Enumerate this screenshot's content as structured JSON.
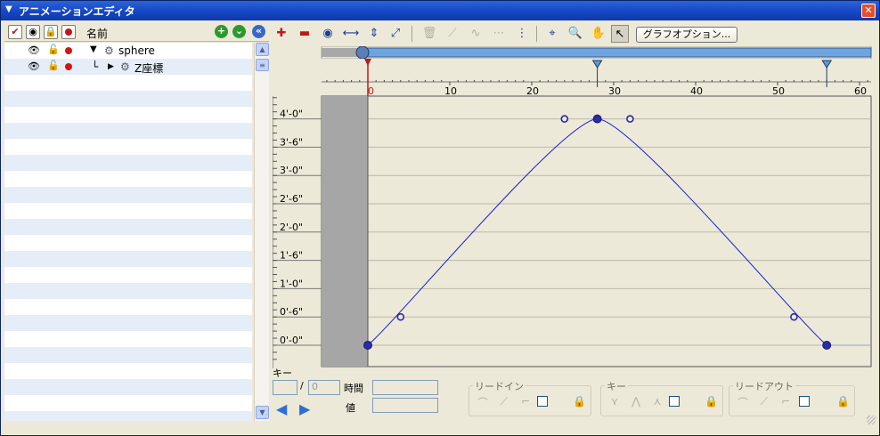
{
  "window": {
    "title": "アニメーションエディタ",
    "close_label": "✕"
  },
  "tree": {
    "name_header": "名前",
    "items": [
      {
        "label": "sphere",
        "expander": "▼"
      },
      {
        "label": "Z座標",
        "expander": "▶"
      }
    ]
  },
  "toolbar": {
    "graph_options_label": "グラフオプション..."
  },
  "graph": {
    "type": "line",
    "ruler_ticks": [
      "0",
      "10",
      "20",
      "30",
      "40",
      "50",
      "60"
    ],
    "y_ticks": [
      "4'-0\"",
      "3'-6\"",
      "3'-0\"",
      "2'-6\"",
      "2'-0\"",
      "1'-6\"",
      "1'-0\"",
      "0'-6\"",
      "0'-0\""
    ],
    "ruler_range": [
      0,
      60
    ],
    "y_range_ft": [
      0,
      4
    ],
    "current_frame": 0,
    "range_markers": [
      28,
      56
    ],
    "curve_color": "#1a1ad6",
    "key_color": "#2b2ba8",
    "keys": [
      {
        "frame": 0,
        "value_ft": 0,
        "handle_out": {
          "frame": 4,
          "value_ft": 0.5
        }
      },
      {
        "frame": 28,
        "value_ft": 4,
        "handle_in": {
          "frame": 24,
          "value_ft": 4
        },
        "handle_out": {
          "frame": 32,
          "value_ft": 4
        }
      },
      {
        "frame": 56,
        "value_ft": 0,
        "handle_in": {
          "frame": 52,
          "value_ft": 0.5
        }
      }
    ],
    "grid": true
  },
  "bottom": {
    "key_label": "キー",
    "slash": "/",
    "key_total": "0",
    "time_label": "時間",
    "value_label": "値",
    "lead_in_label": "リードイン",
    "key_group_label": "キー",
    "lead_out_label": "リードアウト"
  }
}
